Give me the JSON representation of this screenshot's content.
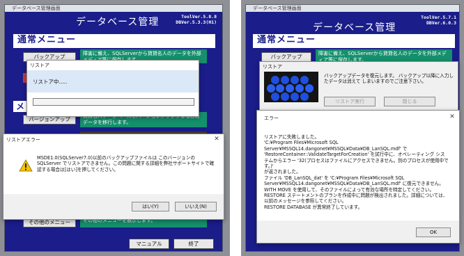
{
  "left": {
    "window_title": "データベース管理画面",
    "app_title": "データベース管理",
    "version_lines": [
      "ToolVer.5.8.8",
      "DBVer.5.3.3(H1)"
    ],
    "section_normal": "通常メニュー",
    "section_other": "メ",
    "backup_button": "バックアップ",
    "backup_desc": "障害に備え、SQLServerから貸貸名人のデータを外部メディア等に保存します。",
    "versionup_button": "バージョンアップ",
    "versionup_desc": "貸貸名人データベースをバージョンアップする場合にデータを移行します。",
    "other_button": "その他のメニュー",
    "other_desc": "その他のメニューを表示します。",
    "manual_button": "マニュアル",
    "exit_button": "終了",
    "restore_dialog": {
      "title": "リストア",
      "status": "リストア中....."
    },
    "error_dialog": {
      "title": "リストアエラー",
      "message": "MSDE1.0(SQLServer7.0)以前のバックアップファイルは このバージョンのSQLServer でリストアできません。この問題に関する詳細を弊社サポートサイトで確認する場合は[はい]を押してください。",
      "yes_button": "はい(Y)",
      "no_button": "いいえ(N)"
    }
  },
  "right": {
    "window_title": "データベース管理画面",
    "app_title": "データベース管理",
    "version_lines": [
      "ToolVer.5.7.1",
      "DBVer.6.0.3"
    ],
    "section_normal": "通常メニュー",
    "backup_button": "バックアップ",
    "backup_desc": "障害に備え、SQLServerから貸貸名人のデータを外部メディア等に保存します。",
    "restore_dialog": {
      "title": "リストア",
      "message": "バックアップデータを復元します。 バックアップ以降に入力したデータは消えて しまいますのでご注意下さい。",
      "run_button": "リストア実行",
      "close_button": "閉じる"
    },
    "error_dialog": {
      "title": "エラー",
      "lines": [
        "リストアに失敗しました。",
        "'C:¥Program Files¥Microsoft SQL",
        "Server¥MSSQL14.dangonet¥MSSQL¥Data¥DB_LanSQL.mdf' で",
        "'RestoreContainer::ValidateTargetForCreation' を試行中に、オペレーティング シス",
        "テムからエラー '32(プロセスはファイルにアクセスできません。別のプロセスが使用中です。)'",
        "が返されました。",
        "ファイル 'DB_LanSQL_dat' を 'C:¥Program Files¥Microsoft SQL",
        "Server¥MSSQL14.dangonet¥MSSQL¥Data¥DB_LanSQL.mdf' に復元できません。",
        "WITH MOVE を使用して、そのファイルによって有効な場所を特定してください。",
        "RESTORE ステートメントのプランを作成中に問題が検出されました。詳細については、",
        "以前のメッセージを参照してください。",
        "RESTORE DATABASE が異常終了しています。"
      ],
      "ok_button": "OK"
    }
  },
  "icons": {
    "warning": "warning-icon",
    "close": "close-icon",
    "database": "database-icon"
  },
  "colors": {
    "app_blue": "#1a1d8a",
    "desc_green": "#15906c",
    "warning_yellow": "#f5c400"
  }
}
